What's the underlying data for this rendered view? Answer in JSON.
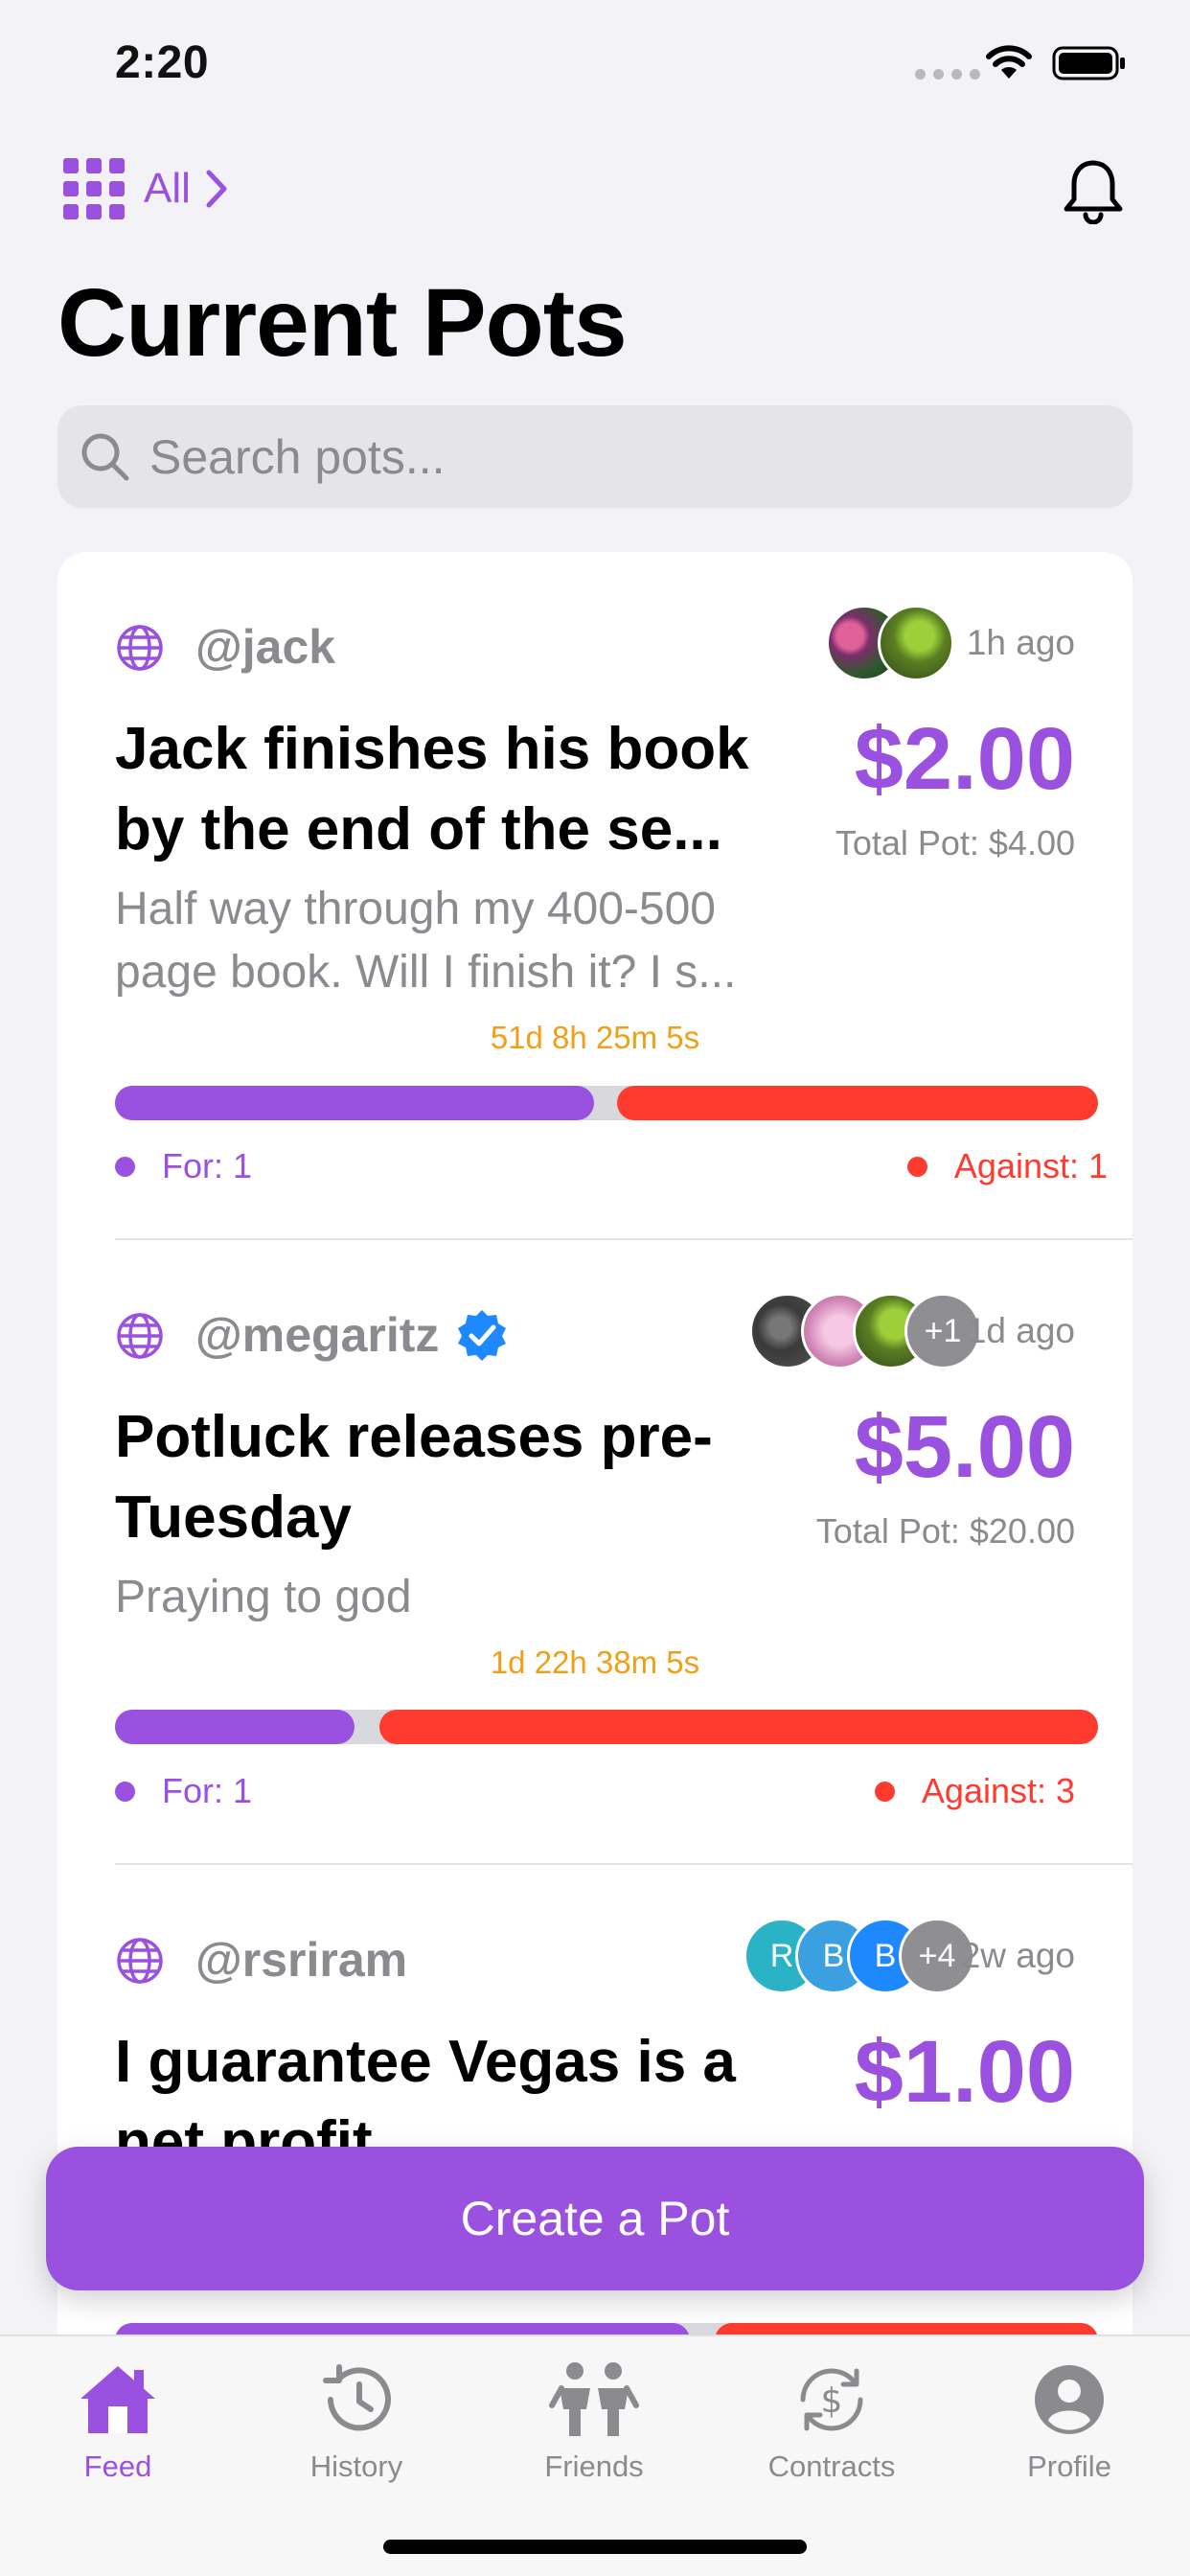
{
  "status_bar": {
    "time": "2:20"
  },
  "top_nav": {
    "filter_label": "All"
  },
  "page_title": "Current Pots",
  "search": {
    "placeholder": "Search pots..."
  },
  "pots": [
    {
      "handle": "@jack",
      "verified": false,
      "time_ago": "1h ago",
      "title": "Jack finishes his book by the end of the se...",
      "amount": "$2.00",
      "total": "Total Pot: $4.00",
      "description": "Half way through my 400-500 page book. Will I finish it? I s...",
      "countdown": "51d 8h 25m 5s",
      "for_label": "For: 1",
      "against_label": "Against: 1",
      "for_share": 0.5,
      "avatars": [
        "flowers-photo",
        "turtle-photo"
      ]
    },
    {
      "handle": "@megaritz",
      "verified": true,
      "time_ago": "1d ago",
      "title": "Potluck releases pre-Tuesday",
      "amount": "$5.00",
      "total": "Total Pot: $20.00",
      "description": "Praying to god",
      "countdown": "1d 22h 38m 5s",
      "for_label": "For: 1",
      "against_label": "Against: 3",
      "for_share": 0.25,
      "avatars": [
        "bar-3-photo",
        "pink-ghost-photo",
        "turtle-photo"
      ],
      "more_avatars": "+1"
    },
    {
      "handle": "@rsriram",
      "verified": false,
      "time_ago": "2w ago",
      "title": "I guarantee Vegas is a net profit",
      "amount": "$1.00",
      "avatars": [
        "R",
        "B",
        "B"
      ],
      "more_avatars": "+4",
      "for_share": 0.6
    }
  ],
  "create_button": "Create a Pot",
  "tabs": [
    {
      "label": "Feed",
      "icon": "house-icon",
      "active": true
    },
    {
      "label": "History",
      "icon": "history-icon",
      "active": false
    },
    {
      "label": "Friends",
      "icon": "people-icon",
      "active": false
    },
    {
      "label": "Contracts",
      "icon": "dollar-cycle-icon",
      "active": false
    },
    {
      "label": "Profile",
      "icon": "person-icon",
      "active": false
    }
  ],
  "colors": {
    "accent": "#9b51e0",
    "against": "#ff3b30",
    "countdown": "#f0a018",
    "secondary_text": "#8a8a8f"
  }
}
